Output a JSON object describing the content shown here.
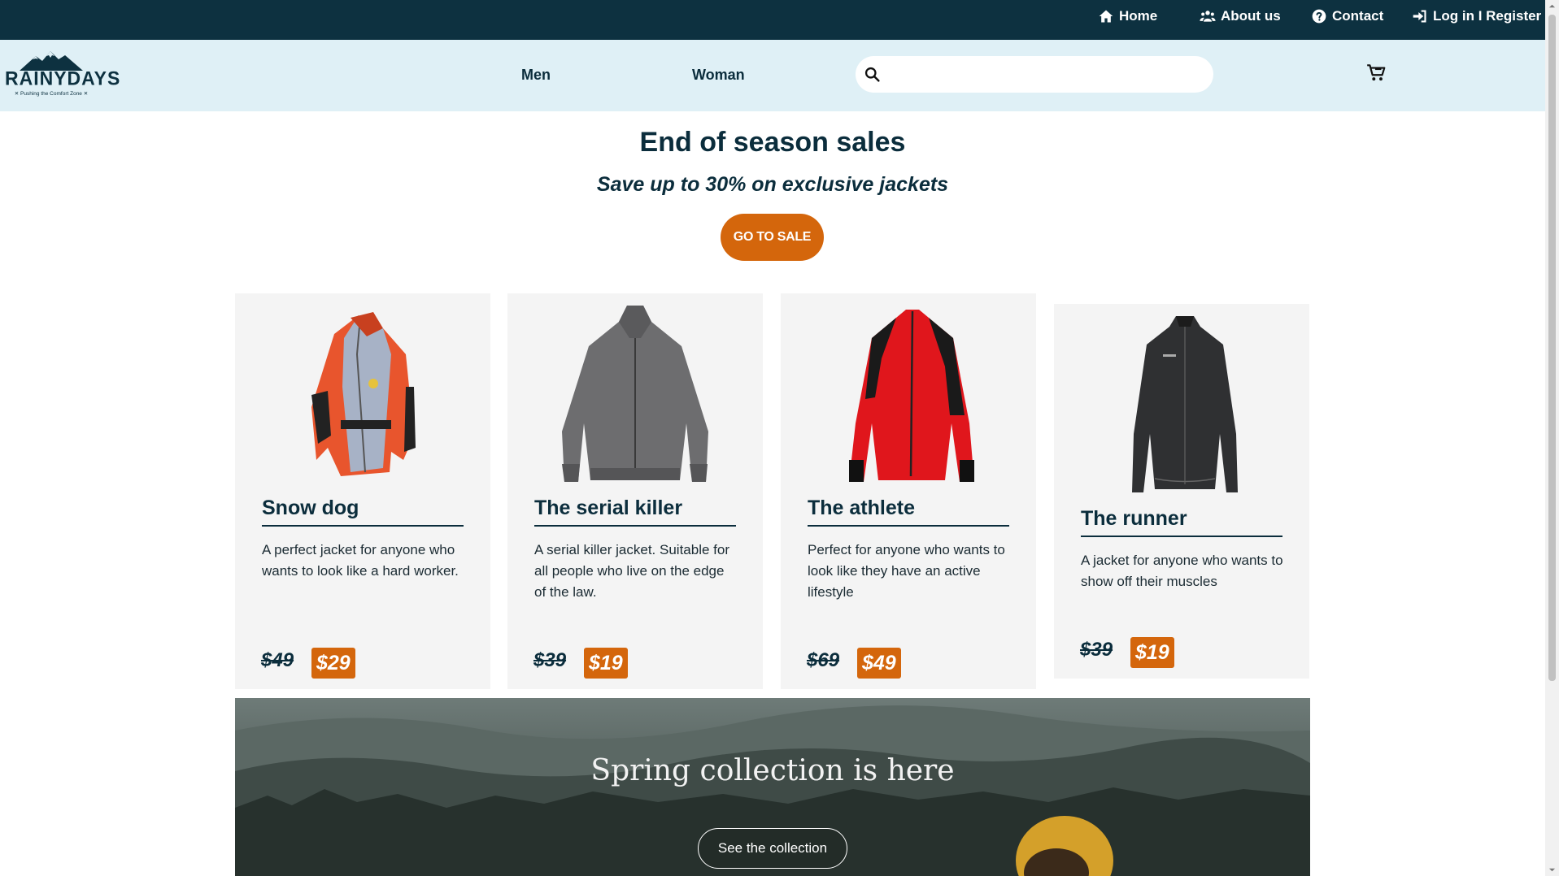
{
  "topbar": {
    "links": [
      {
        "label": "Home",
        "icon": "home-icon"
      },
      {
        "label": "About us",
        "icon": "users-icon"
      },
      {
        "label": "Contact",
        "icon": "question-circle-icon"
      },
      {
        "label": "Log in I Register",
        "icon": "sign-in-icon"
      }
    ]
  },
  "header": {
    "logo": {
      "text": "RAINYDAYS",
      "tagline": "✕ Pushing the Comfort Zone ✕"
    },
    "nav": [
      {
        "label": "Men"
      },
      {
        "label": "Woman"
      }
    ],
    "search": {
      "placeholder": "",
      "value": ""
    },
    "cart_icon": "cart-icon"
  },
  "hero": {
    "title": "End of season sales",
    "subtitle": "Save up to 30% on exclusive jackets",
    "cta": "GO TO SALE"
  },
  "products": [
    {
      "name": "Snow dog",
      "description": "A perfect jacket for anyone who wants to look like a hard worker.",
      "old_price": "$49",
      "new_price": "$29"
    },
    {
      "name": "The serial killer",
      "description": "A serial killer jacket. Suitable for all people who live on the edge of the law.",
      "old_price": "$39",
      "new_price": "$19"
    },
    {
      "name": "The athlete",
      "description": "Perfect for anyone who wants to look like they have an active lifestyle",
      "old_price": "$69",
      "new_price": "$49"
    },
    {
      "name": "The runner",
      "description": "A jacket for anyone who wants to show off their muscles",
      "old_price": "$39",
      "new_price": "$19"
    }
  ],
  "banner": {
    "title": "Spring collection is here",
    "button": "See the collection"
  },
  "colors": {
    "topbar": "#0d3140",
    "header": "#dff0f6",
    "accent": "#d4660c",
    "text": "#0b2d3c",
    "card": "#f4f4f4"
  }
}
